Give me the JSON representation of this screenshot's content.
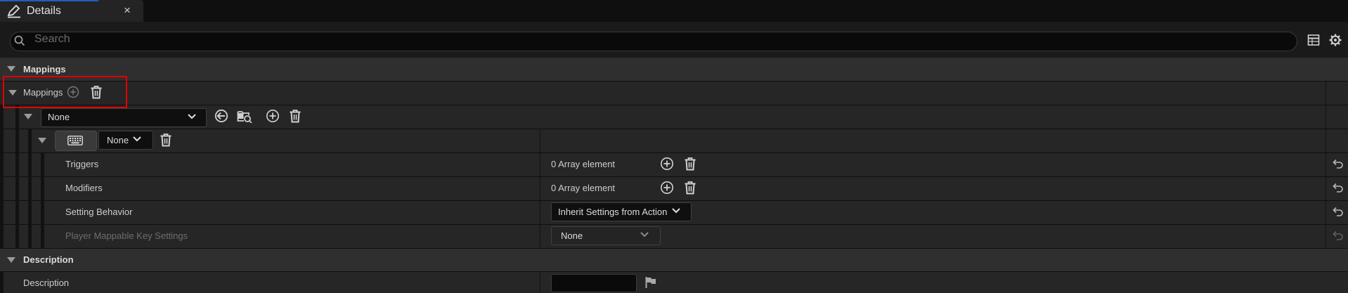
{
  "tab": {
    "title": "Details",
    "close_glyph": "×",
    "icon": "pencil-details-icon"
  },
  "search": {
    "placeholder": "Search",
    "icon": "search-icon"
  },
  "toolbar": {
    "icons": [
      "table-view-icon",
      "settings-gear-icon"
    ]
  },
  "sections": {
    "mappings_header": "Mappings",
    "mappings_array_label": "Mappings",
    "mapping_element": {
      "action_value": "None",
      "key_value": "None",
      "key_icon": "keyboard-icon"
    },
    "properties": [
      {
        "label": "Triggers",
        "value": "0 Array element"
      },
      {
        "label": "Modifiers",
        "value": "0 Array element"
      },
      {
        "label": "Setting Behavior",
        "value": "Inherit Settings from Action"
      },
      {
        "label": "Player Mappable Key Settings",
        "value": "None"
      }
    ],
    "description_header": "Description",
    "description_label": "Description"
  },
  "colors": {
    "accent": "#1f5fbf",
    "highlight": "#e00000",
    "background": "#1a1a1a"
  }
}
